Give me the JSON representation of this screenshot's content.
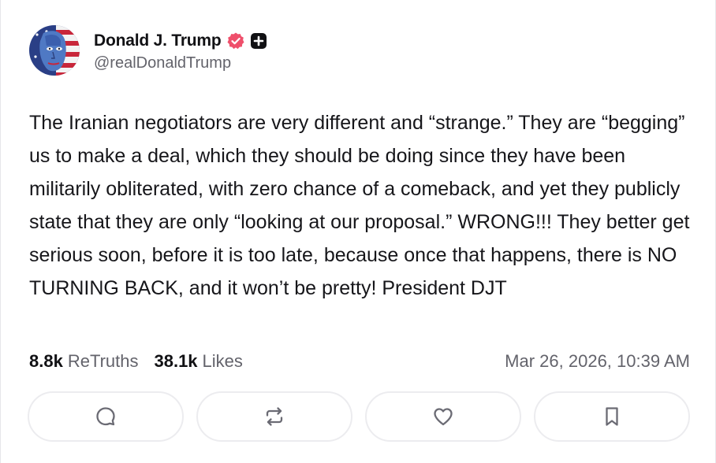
{
  "author": {
    "display_name": "Donald J. Trump",
    "handle": "@realDonaldTrump",
    "avatar_icon": "avatar-image",
    "verified_icon": "verified-badge-icon",
    "verified_color": "#ef4f6b",
    "plus_icon": "plus-badge-icon"
  },
  "post": {
    "text": "The Iranian negotiators are very different and “strange.” They are “begging” us to make a deal, which they should be doing since they have been militarily obliterated, with zero chance of a comeback, and yet they publicly state that they are only “looking at our proposal.” WRONG!!! They better get serious soon, before it is too late, because once that happens, there is NO TURNING BACK, and it won’t be pretty! President DJT",
    "retruths_count": "8.8k",
    "retruths_label": "ReTruths",
    "likes_count": "38.1k",
    "likes_label": "Likes",
    "timestamp": "Mar 26, 2026, 10:39 AM"
  },
  "actions": [
    {
      "name": "reply",
      "icon": "reply-icon"
    },
    {
      "name": "retruth",
      "icon": "retruth-icon"
    },
    {
      "name": "like",
      "icon": "heart-icon"
    },
    {
      "name": "bookmark",
      "icon": "bookmark-icon"
    }
  ],
  "colors": {
    "text": "#16161a",
    "muted": "#63636b",
    "border": "#ececef",
    "icon": "#6b6b74"
  }
}
